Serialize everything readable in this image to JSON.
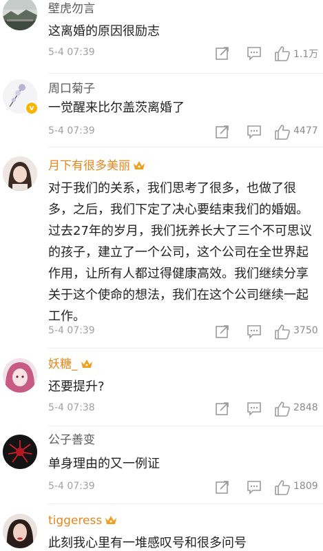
{
  "comments": [
    {
      "username": "壁虎勿言",
      "text": "这离婚的原因很励志",
      "time": "5-4 07:39",
      "likes": "1.1万",
      "avatar_icon": "landscape-avatar",
      "vip": false
    },
    {
      "username": "周口菊子",
      "text": "一觉醒来比尔盖茨离婚了",
      "time": "5-4 07:39",
      "likes": "4477",
      "avatar_icon": "flower-avatar",
      "verified_badge": "v",
      "vip": false
    },
    {
      "username": "月下有很多美丽",
      "text": "对于我们的关系，我们思考了很多，也做了很多，之后，我们下定了决心要结束我们的婚姻。过去27年的岁月，我们抚养长大了三个不可思议的孩子，建立了一个公司，这个公司在全世界起作用，让所有人都过得健康高效。我们继续分享关于这个使命的想法，我们在这个公司继续一起工作。",
      "time": "5-4 07:39",
      "likes": "3750",
      "avatar_icon": "girl-avatar",
      "vip": true
    },
    {
      "username": "妖糖_",
      "text": "还要提升?",
      "time": "5-4 07:38",
      "likes": "2848",
      "avatar_icon": "anime-avatar",
      "vip": true
    },
    {
      "username": "公子善变",
      "text": "单身理由的又一例证",
      "time": "5-4 07:39",
      "likes": "1809",
      "avatar_icon": "red-flower-avatar",
      "vip": false
    },
    {
      "username": "tiggeress",
      "text": "此刻我心里有一堆感叹号和很多问号",
      "avatar_icon": "woman-avatar",
      "vip": true
    }
  ],
  "colors": {
    "vip_name": "#e8861a",
    "normal_name": "#5a5a5a",
    "meta": "#a0a0a0",
    "icon": "#9a9a9a",
    "badge": "#f7b500"
  }
}
